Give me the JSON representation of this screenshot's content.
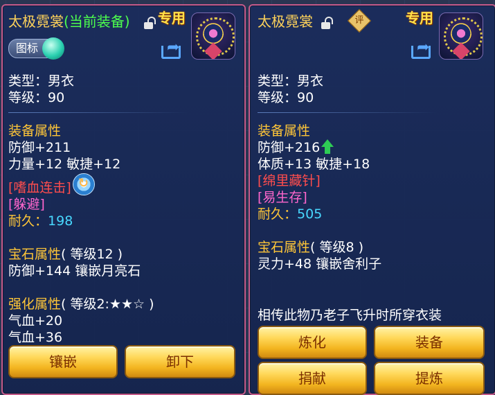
{
  "left": {
    "title": "太极霓裳",
    "equipped_tag": "(当前装备)",
    "exclusive": "专用",
    "icon_pill": "图标",
    "type": "类型：男衣",
    "level": "等级：90",
    "attr_header": "装备属性",
    "defense": "防御+211",
    "stats": "力量+12 敏捷+12",
    "skill1": "[嗜血连击]",
    "skill2": "[躲避]",
    "durability_label": "耐久：",
    "durability_value": "198",
    "gem_header": "宝石属性",
    "gem_level": "( 等级12 )",
    "gem_effect": "防御+144 镶嵌月亮石",
    "enhance_header": "强化属性",
    "enhance_level": "( 等级2:★★☆ )",
    "enhance1": "气血+20",
    "enhance2": "气血+36",
    "buttons": {
      "inlay": "镶嵌",
      "unequip": "卸下"
    }
  },
  "right": {
    "title": "太极霓裳",
    "exclusive": "专用",
    "review_badge": "评",
    "type": "类型：男衣",
    "level": "等级：90",
    "attr_header": "装备属性",
    "defense": "防御+216",
    "stats": "体质+13 敏捷+18",
    "skill1": "[绵里藏针]",
    "skill2": "[易生存]",
    "durability_label": "耐久：",
    "durability_value": "505",
    "gem_header": "宝石属性",
    "gem_level": "( 等级8 )",
    "gem_effect": "灵力+48 镶嵌舍利子",
    "description": "相传此物乃老子飞升时所穿衣装",
    "buttons": {
      "refine": "炼化",
      "equip": "装备",
      "donate": "捐献",
      "extract": "提炼"
    }
  },
  "colors": {
    "title": "#ffd35a",
    "equipped": "#4dff4d",
    "section_header": "#ffc638",
    "red_skill": "#ff4d4d",
    "pink_skill": "#ff66cc",
    "durability": "#48d8ff",
    "panel_border": "#c45a8a",
    "button": "#ffd85a"
  }
}
